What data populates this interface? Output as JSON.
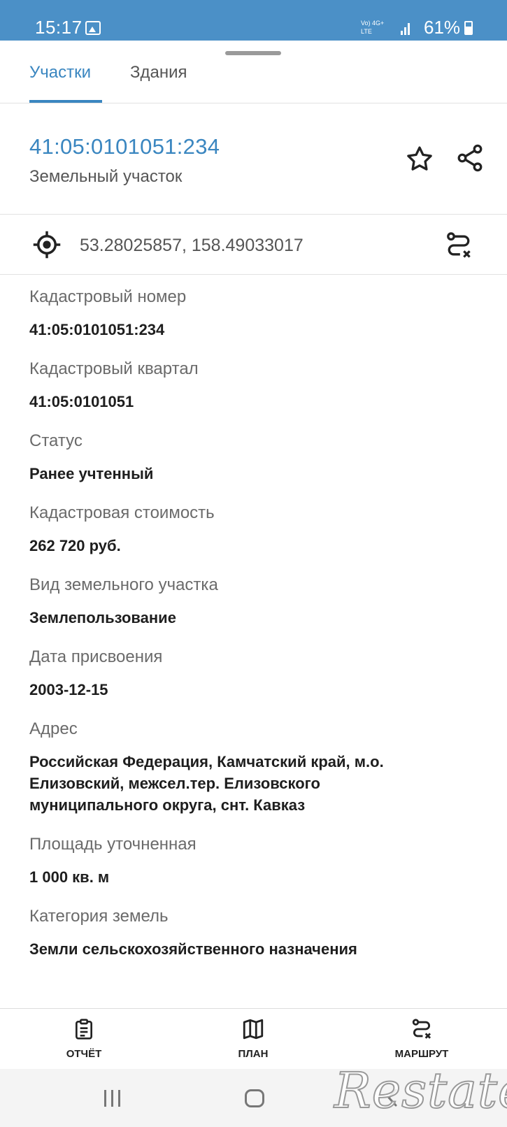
{
  "status_bar": {
    "time": "15:17",
    "network_top": "Vo) 4G+",
    "network_bottom": "LTE",
    "battery": "61%"
  },
  "tabs": [
    {
      "label": "Участки",
      "active": true
    },
    {
      "label": "Здания",
      "active": false
    }
  ],
  "header": {
    "cadastral_number": "41:05:0101051:234",
    "object_type": "Земельный участок",
    "actions": [
      "star-icon",
      "share-icon"
    ]
  },
  "coordinates": {
    "value": "53.28025857, 158.49033017",
    "icon": "target-icon",
    "action_icon": "route-icon"
  },
  "details": [
    {
      "label": "Кадастровый номер",
      "value": "41:05:0101051:234"
    },
    {
      "label": "Кадастровый квартал",
      "value": "41:05:0101051"
    },
    {
      "label": "Статус",
      "value": "Ранее учтенный"
    },
    {
      "label": "Кадастровая стоимость",
      "value": "262 720 руб."
    },
    {
      "label": "Вид земельного участка",
      "value": "Землепользование"
    },
    {
      "label": "Дата присвоения",
      "value": "2003-12-15"
    },
    {
      "label": "Адрес",
      "value": "Российская Федерация, Камчатский край, м.о. Елизовский, межсел.тер. Елизовского муниципального округа, снт. Кавказ"
    },
    {
      "label": "Площадь уточненная",
      "value": "1 000 кв. м"
    },
    {
      "label": "Категория земель",
      "value": "Земли сельскохозяйственного назначения"
    }
  ],
  "bottom_nav": [
    {
      "label": "ОТЧЁТ",
      "icon": "report-icon"
    },
    {
      "label": "ПЛАН",
      "icon": "map-icon"
    },
    {
      "label": "МАРШРУТ",
      "icon": "route-icon"
    }
  ],
  "watermark": "Restate",
  "colors": {
    "status_bar": "#4b90c7",
    "accent": "#3a86c0"
  }
}
